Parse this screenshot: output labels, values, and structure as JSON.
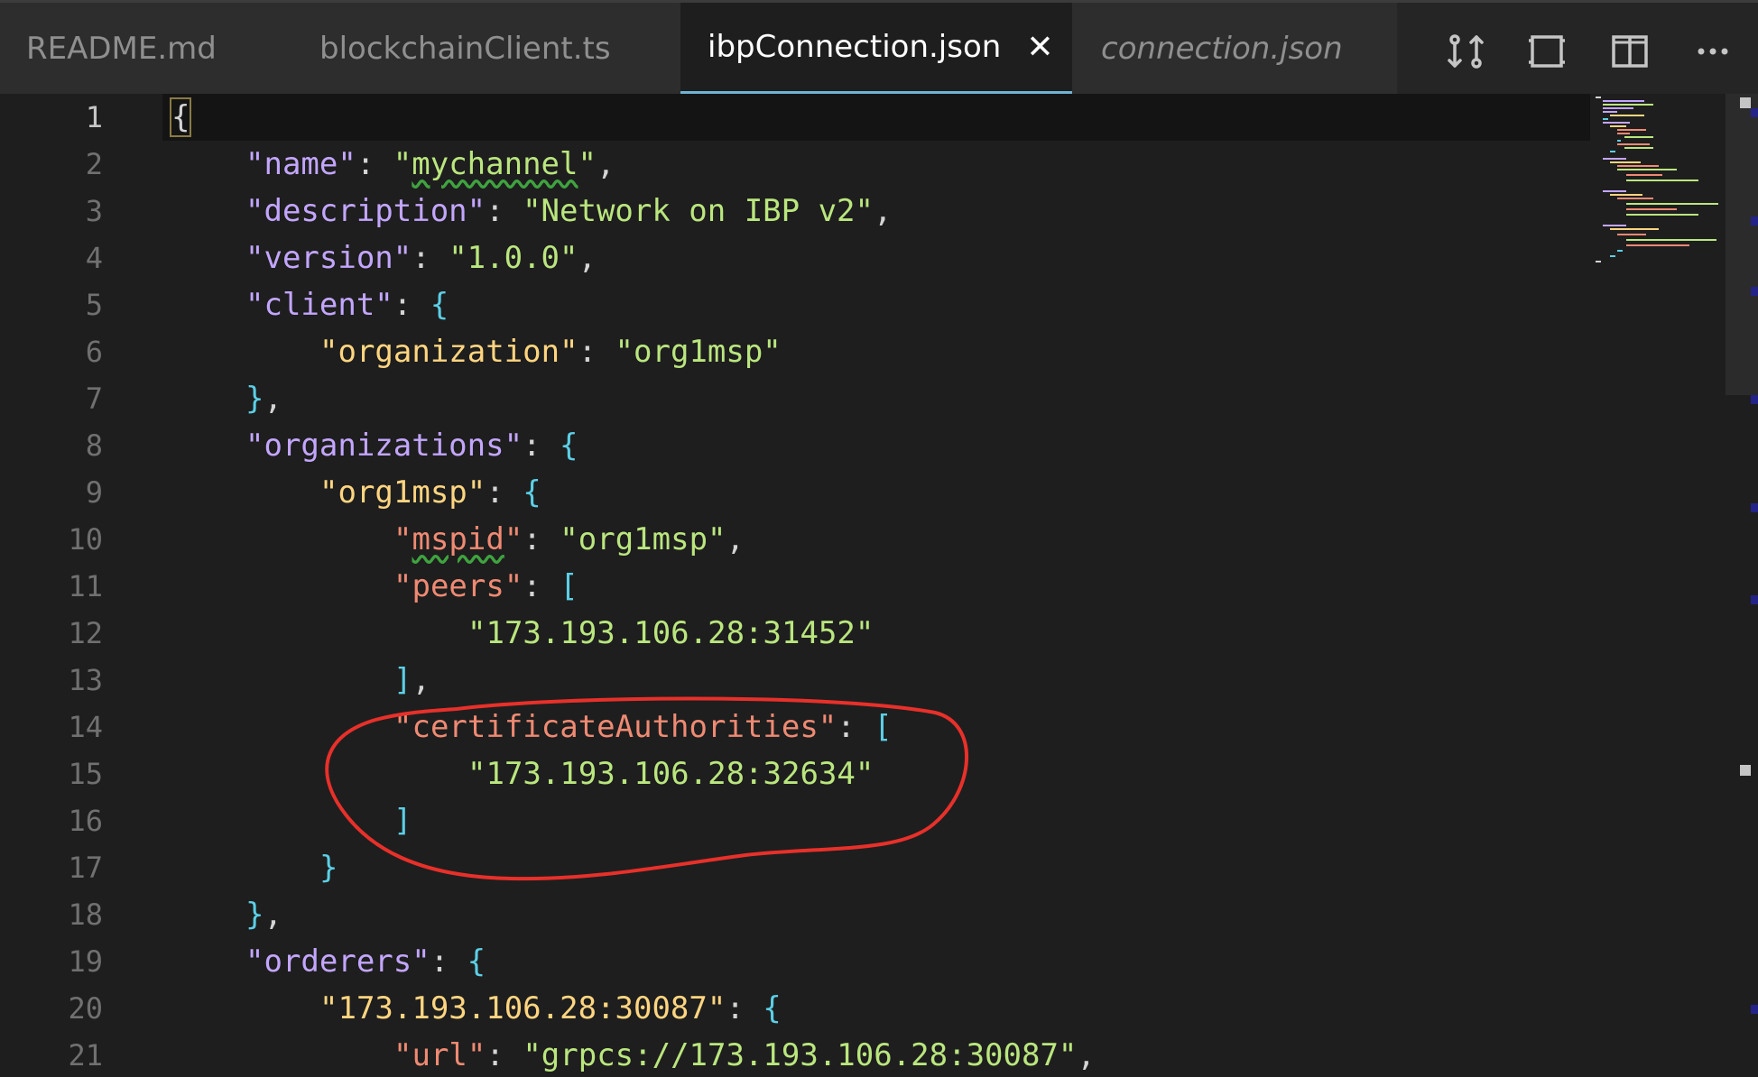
{
  "tabs": [
    {
      "label": "README.md"
    },
    {
      "label": "blockchainClient.ts"
    },
    {
      "label": "ibpConnection.json",
      "active": true,
      "close_glyph": "✕"
    },
    {
      "label": "connection.json",
      "preview": true
    }
  ],
  "actions": [
    {
      "icon": "compare-changes-icon"
    },
    {
      "icon": "toggle-maximize-icon"
    },
    {
      "icon": "split-editor-icon"
    },
    {
      "icon": "more-actions-icon"
    }
  ],
  "line_numbers": [
    "1",
    "2",
    "3",
    "4",
    "5",
    "6",
    "7",
    "8",
    "9",
    "10",
    "11",
    "12",
    "13",
    "14",
    "15",
    "16",
    "17",
    "18",
    "19",
    "20",
    "21"
  ],
  "code": {
    "l1": {
      "brace": "{"
    },
    "l2": {
      "key": "\"name\"",
      "colon": ": ",
      "q1": "\"",
      "val": "mychannel",
      "q2": "\"",
      "comma": ","
    },
    "l3": {
      "key": "\"description\"",
      "colon": ": ",
      "val": "\"Network on IBP v2\"",
      "comma": ","
    },
    "l4": {
      "key": "\"version\"",
      "colon": ": ",
      "val": "\"1.0.0\"",
      "comma": ","
    },
    "l5": {
      "key": "\"client\"",
      "colon": ": ",
      "brace": "{"
    },
    "l6": {
      "key": "\"organization\"",
      "colon": ": ",
      "val": "\"org1msp\""
    },
    "l7": {
      "brace": "}",
      "comma": ","
    },
    "l8": {
      "key": "\"organizations\"",
      "colon": ": ",
      "brace": "{"
    },
    "l9": {
      "key": "\"org1msp\"",
      "colon": ": ",
      "brace": "{"
    },
    "l10": {
      "q1": "\"",
      "key": "mspid",
      "q2": "\"",
      "colon": ": ",
      "val": "\"org1msp\"",
      "comma": ","
    },
    "l11": {
      "key": "\"peers\"",
      "colon": ": ",
      "brace": "["
    },
    "l12": {
      "val": "\"173.193.106.28:31452\""
    },
    "l13": {
      "brace": "]",
      "comma": ","
    },
    "l14": {
      "key": "\"certificateAuthorities\"",
      "colon": ": ",
      "brace": "["
    },
    "l15": {
      "val": "\"173.193.106.28:32634\""
    },
    "l16": {
      "brace": "]"
    },
    "l17": {
      "brace": "}"
    },
    "l18": {
      "brace": "}",
      "comma": ","
    },
    "l19": {
      "key": "\"orderers\"",
      "colon": ": ",
      "brace": "{"
    },
    "l20": {
      "key": "\"173.193.106.28:30087\"",
      "colon": ": ",
      "brace": "{"
    },
    "l21": {
      "key": "\"url\"",
      "colon": ": ",
      "val": "\"grpcs://173.193.106.28:30087\"",
      "comma": ","
    }
  },
  "colors": {
    "background": "#1e1e1e",
    "tabbar": "#252526",
    "active_tab_border": "#6fb3d2",
    "key_purple": "#c3a6ff",
    "key_yellow": "#ffd580",
    "key_orange": "#ef8a73",
    "string_green": "#bae67e",
    "brace_cyan": "#5ccfe6",
    "annotation_red": "#e8302a"
  }
}
